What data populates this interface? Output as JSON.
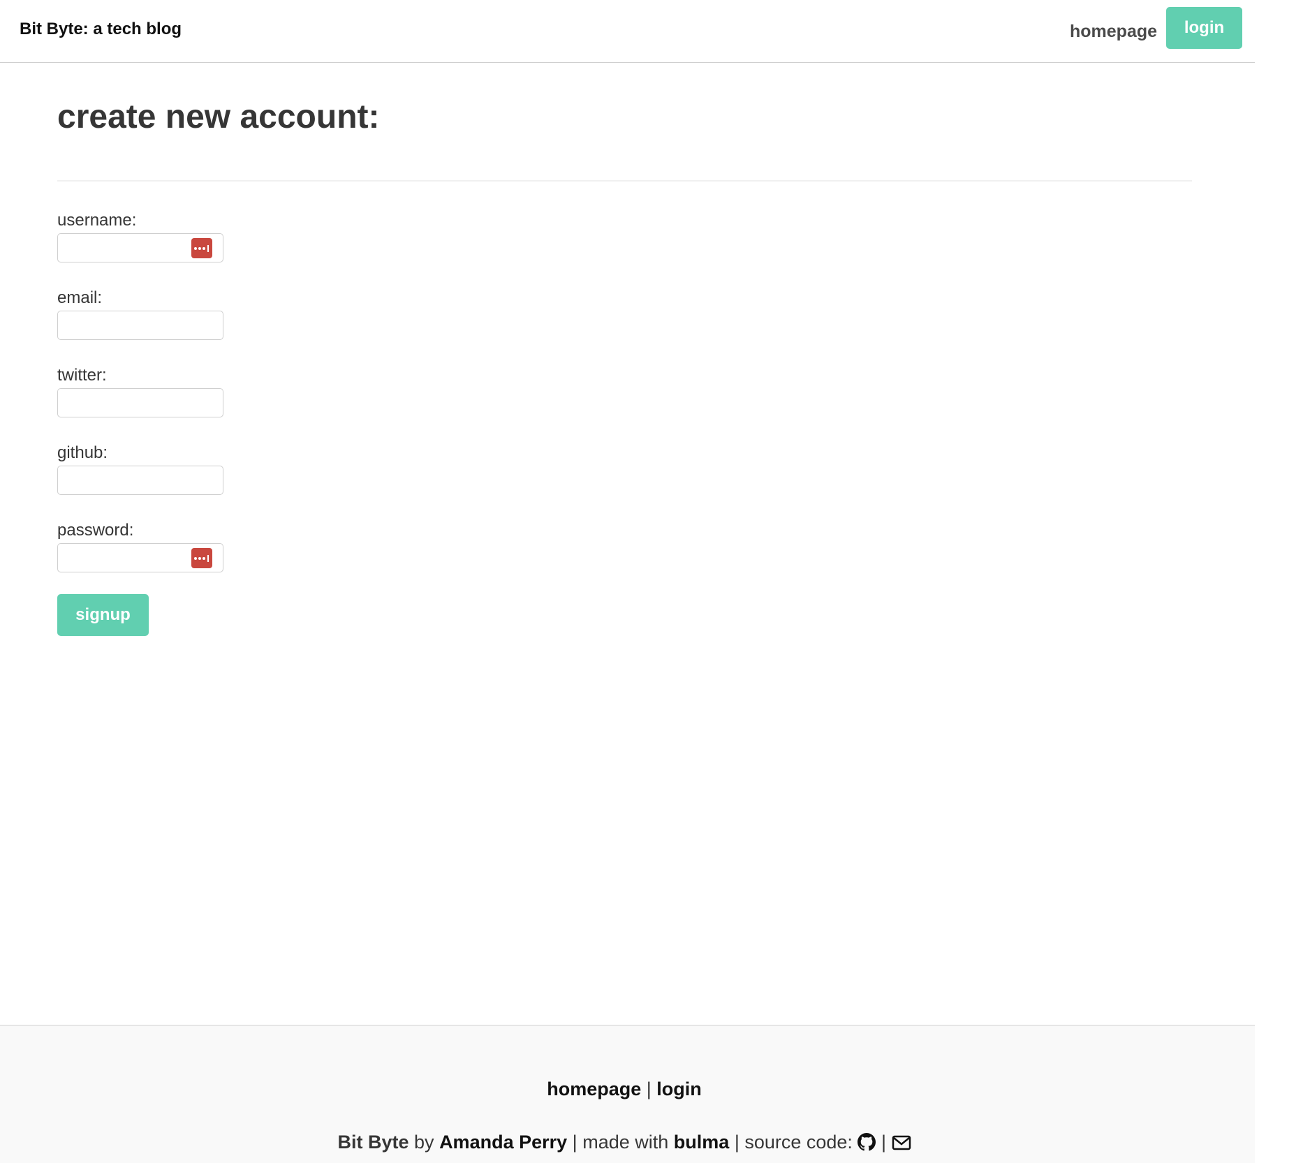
{
  "navbar": {
    "brand": "Bit Byte: a tech blog",
    "homepage": "homepage",
    "login": "login"
  },
  "main": {
    "title": "create new account:",
    "fields": [
      {
        "label": "username:",
        "value": "",
        "has_password_manager_icon": true
      },
      {
        "label": "email:",
        "value": "",
        "has_password_manager_icon": false
      },
      {
        "label": "twitter:",
        "value": "",
        "has_password_manager_icon": false
      },
      {
        "label": "github:",
        "value": "",
        "has_password_manager_icon": false
      },
      {
        "label": "password:",
        "value": "",
        "has_password_manager_icon": true
      }
    ],
    "signup": "signup"
  },
  "footer": {
    "nav_homepage": "homepage",
    "nav_separator": "|",
    "nav_login": "login",
    "site_name": "Bit Byte",
    "by": "by",
    "author": "Amanda Perry",
    "sep1": "|",
    "made_with": "made with",
    "framework": "bulma",
    "sep2": "|",
    "source_code": "source code:",
    "sep3": "|",
    "icons": [
      "github-icon",
      "envelope-icon"
    ]
  },
  "colors": {
    "accent": "#61cfb0",
    "password_manager_icon": "#c9473e",
    "footer_background": "#f9f9f9",
    "text": "#363636"
  }
}
